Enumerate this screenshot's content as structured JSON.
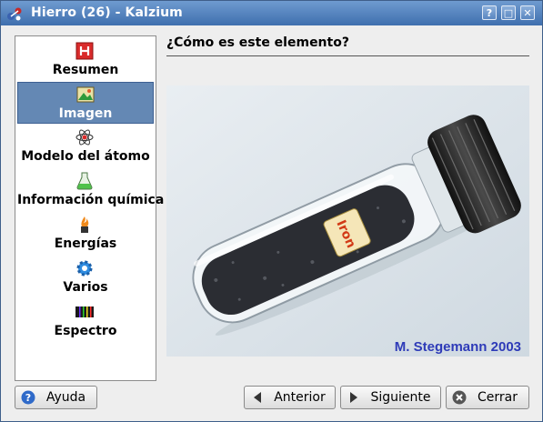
{
  "window": {
    "title": "Hierro (26) - Kalzium",
    "controls": {
      "help": "?",
      "maximize": "□",
      "close": "✕"
    }
  },
  "sidebar": {
    "items": [
      {
        "label": "Resumen",
        "icon": "summary-h-icon"
      },
      {
        "label": "Imagen",
        "icon": "image-icon",
        "active": true
      },
      {
        "label": "Modelo del átomo",
        "icon": "atom-icon"
      },
      {
        "label": "Información química",
        "icon": "flask-icon"
      },
      {
        "label": "Energías",
        "icon": "flame-icon"
      },
      {
        "label": "Varios",
        "icon": "gear-icon"
      },
      {
        "label": "Espectro",
        "icon": "spectrum-icon"
      }
    ]
  },
  "main": {
    "heading": "¿Cómo es este elemento?",
    "image": {
      "vial_label": "Iron",
      "credit": "M. Stegemann 2003"
    }
  },
  "buttons": {
    "help": "Ayuda",
    "previous": "Anterior",
    "next": "Siguiente",
    "close": "Cerrar"
  },
  "colors": {
    "titlebar": "#4f7fbf",
    "selection": "#6488b4",
    "credit": "#2e3bb8"
  }
}
